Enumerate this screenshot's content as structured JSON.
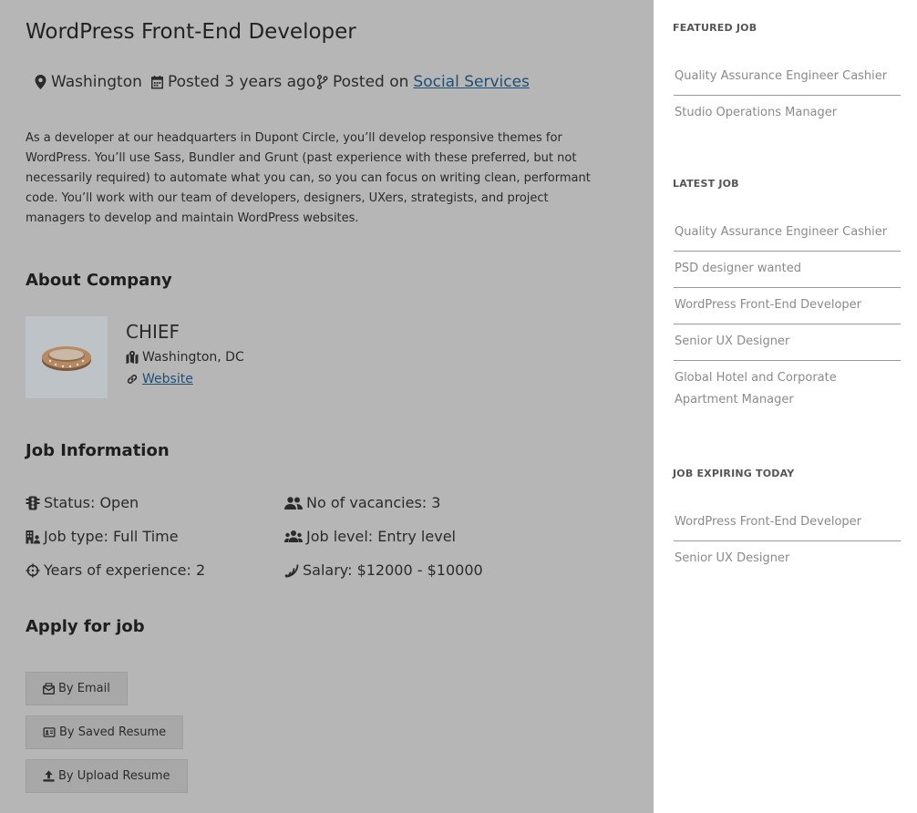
{
  "job": {
    "title": "WordPress Front-End Developer",
    "location": "Washington",
    "posted": "Posted 3 years ago",
    "posted_on_label": "Posted on",
    "category": "Social Services",
    "description": "As a developer at our headquarters in Dupont Circle, you’ll develop responsive themes for WordPress. You’ll use Sass, Bundler and Grunt (past experience with these preferred, but not necessarily required) to automate what you can, so you can focus on writing clean, performant code. You’ll work with our team of developers, designers, UXers, strategists, and project managers to develop and maintain WordPress websites."
  },
  "about": {
    "heading": "About Company",
    "company_name": "CHIEF",
    "company_location": "Washington, DC",
    "website_label": "Website"
  },
  "job_info": {
    "heading": "Job Information",
    "status": "Status: Open",
    "vacancies": "No of vacancies: 3",
    "job_type": "Job type: Full Time",
    "job_level": "Job level: Entry level",
    "experience": "Years of experience: 2",
    "salary": "Salary: $12000 - $10000"
  },
  "apply": {
    "heading": "Apply for job",
    "by_email": "By Email",
    "by_saved_resume": "By Saved Resume",
    "by_upload_resume": "By Upload Resume"
  },
  "sidebar": {
    "featured_heading": "FEATURED JOB",
    "featured": [
      "Quality Assurance Engineer Cashier",
      "Studio Operations Manager"
    ],
    "latest_heading": "LATEST JOB",
    "latest": [
      "Quality Assurance Engineer Cashier",
      "PSD designer wanted",
      "WordPress Front-End Developer",
      "Senior UX Designer",
      "Global Hotel and Corporate Apartment Manager"
    ],
    "expiring_heading": "JOB EXPIRING TODAY",
    "expiring": [
      "WordPress Front-End Developer",
      "Senior UX Designer"
    ]
  },
  "colors": {
    "main_background": "#b6b6b6",
    "link": "#1f4f74",
    "button_background": "#a8a8a8"
  }
}
